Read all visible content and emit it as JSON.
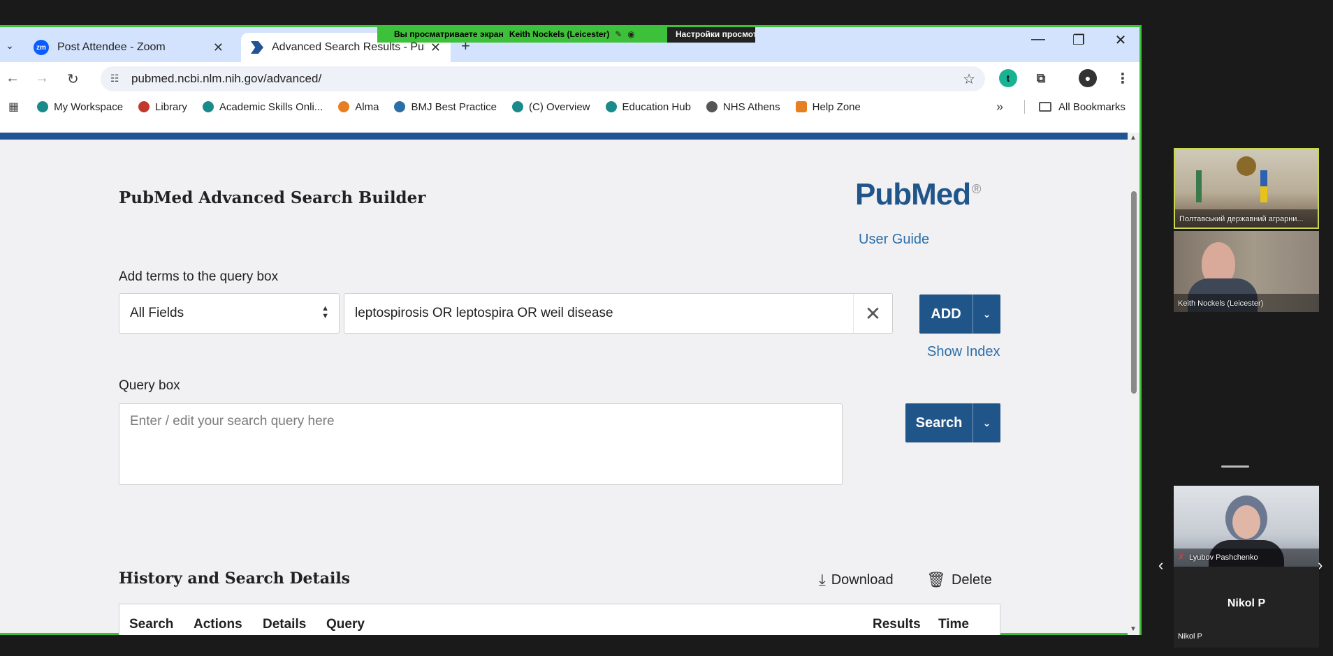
{
  "browser": {
    "tabs": [
      {
        "label": "Post Attendee - Zoom",
        "icon": "zm"
      },
      {
        "label": "Advanced Search Results - PubMed",
        "icon": "pubmed"
      }
    ],
    "url": "pubmed.ncbi.nlm.nih.gov/advanced/",
    "extension_letter": "t"
  },
  "share_banner": {
    "viewing_text": "Вы просматриваете экран",
    "presenter": "Keith Nockels (Leicester)",
    "view_options": "Настройки просмотра"
  },
  "bookmarks": {
    "items": [
      {
        "label": "My Workspace",
        "color": "#1b8a8a"
      },
      {
        "label": "Library",
        "color": "#c0392b"
      },
      {
        "label": "Academic Skills Onli...",
        "color": "#1b8a8a"
      },
      {
        "label": "Alma",
        "color": "#e67e22"
      },
      {
        "label": "BMJ Best Practice",
        "color": "#2b6ea8"
      },
      {
        "label": "(C) Overview",
        "color": "#1b8a8a"
      },
      {
        "label": "Education Hub",
        "color": "#1b8a8a"
      },
      {
        "label": "NHS Athens",
        "color": "#555555"
      },
      {
        "label": "Help Zone",
        "color": "#e67e22"
      }
    ],
    "all_bookmarks": "All Bookmarks"
  },
  "page": {
    "title": "PubMed Advanced Search Builder",
    "logo": "PubMed",
    "user_guide": "User Guide",
    "add_terms_label": "Add terms to the query box",
    "field_select": "All Fields",
    "term_value": "leptospirosis OR leptospira OR weil disease",
    "add_button": "ADD",
    "show_index": "Show Index",
    "query_box_label": "Query box",
    "query_placeholder": "Enter / edit your search query here",
    "search_button": "Search",
    "history_title": "History and Search Details",
    "download": "Download",
    "delete": "Delete",
    "table_headers": [
      "Search",
      "Actions",
      "Details",
      "Query",
      "Results",
      "Time"
    ]
  },
  "zoom_panel": {
    "participants": [
      {
        "name": "Полтавський державний аграрни..."
      },
      {
        "name": "Keith Nockels (Leicester)"
      },
      {
        "name": "Lyubov Pashchenko"
      },
      {
        "name": "Nikol P"
      }
    ]
  },
  "colors": {
    "accent": "#20558a",
    "share_border": "#3ec13a",
    "tabbar": "#d3e3fd"
  }
}
